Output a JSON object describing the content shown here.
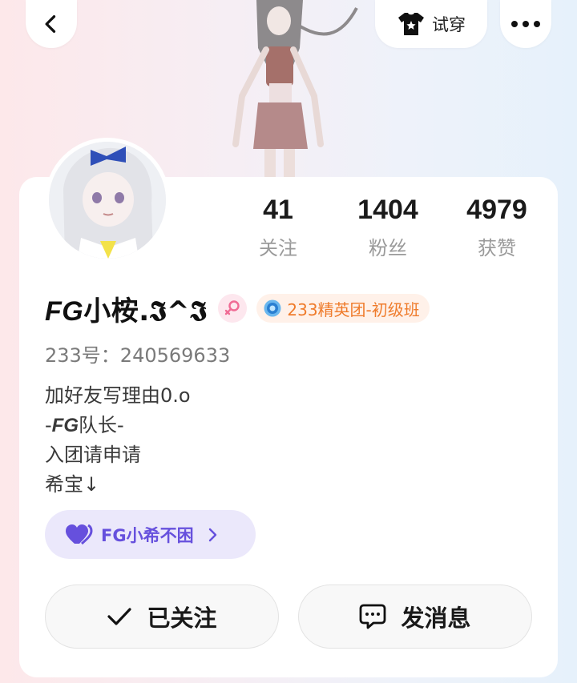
{
  "header": {
    "back_icon": "chevron-left-icon",
    "try_on_label": "试穿",
    "try_on_icon": "tshirt-icon",
    "more_icon": "more-dots-icon"
  },
  "stats": [
    {
      "value": "41",
      "label": "关注"
    },
    {
      "value": "1404",
      "label": "粉丝"
    },
    {
      "value": "4979",
      "label": "获赞"
    }
  ],
  "profile": {
    "nickname_prefix": "FG",
    "nickname_rest": "小桉.𝕴^𝕴",
    "gender_icon": "female-icon",
    "team_badge": "233精英团-初级班",
    "uid": "233号：240569633",
    "bio_lines": [
      "加好友写理由0.o",
      "-FG队长-",
      "入团请申请",
      "希宝↓"
    ],
    "bio_line2_prefix": "-",
    "bio_line2_italic": "FG",
    "bio_line2_rest": "队长-"
  },
  "group_chip": {
    "label": "FG小希不困",
    "icon": "heart-link-icon"
  },
  "actions": {
    "follow_label": "已关注",
    "message_label": "发消息"
  },
  "colors": {
    "accent_purple": "#6650dd",
    "badge_orange": "#ef7b2b",
    "gender_pink": "#f06b95"
  }
}
